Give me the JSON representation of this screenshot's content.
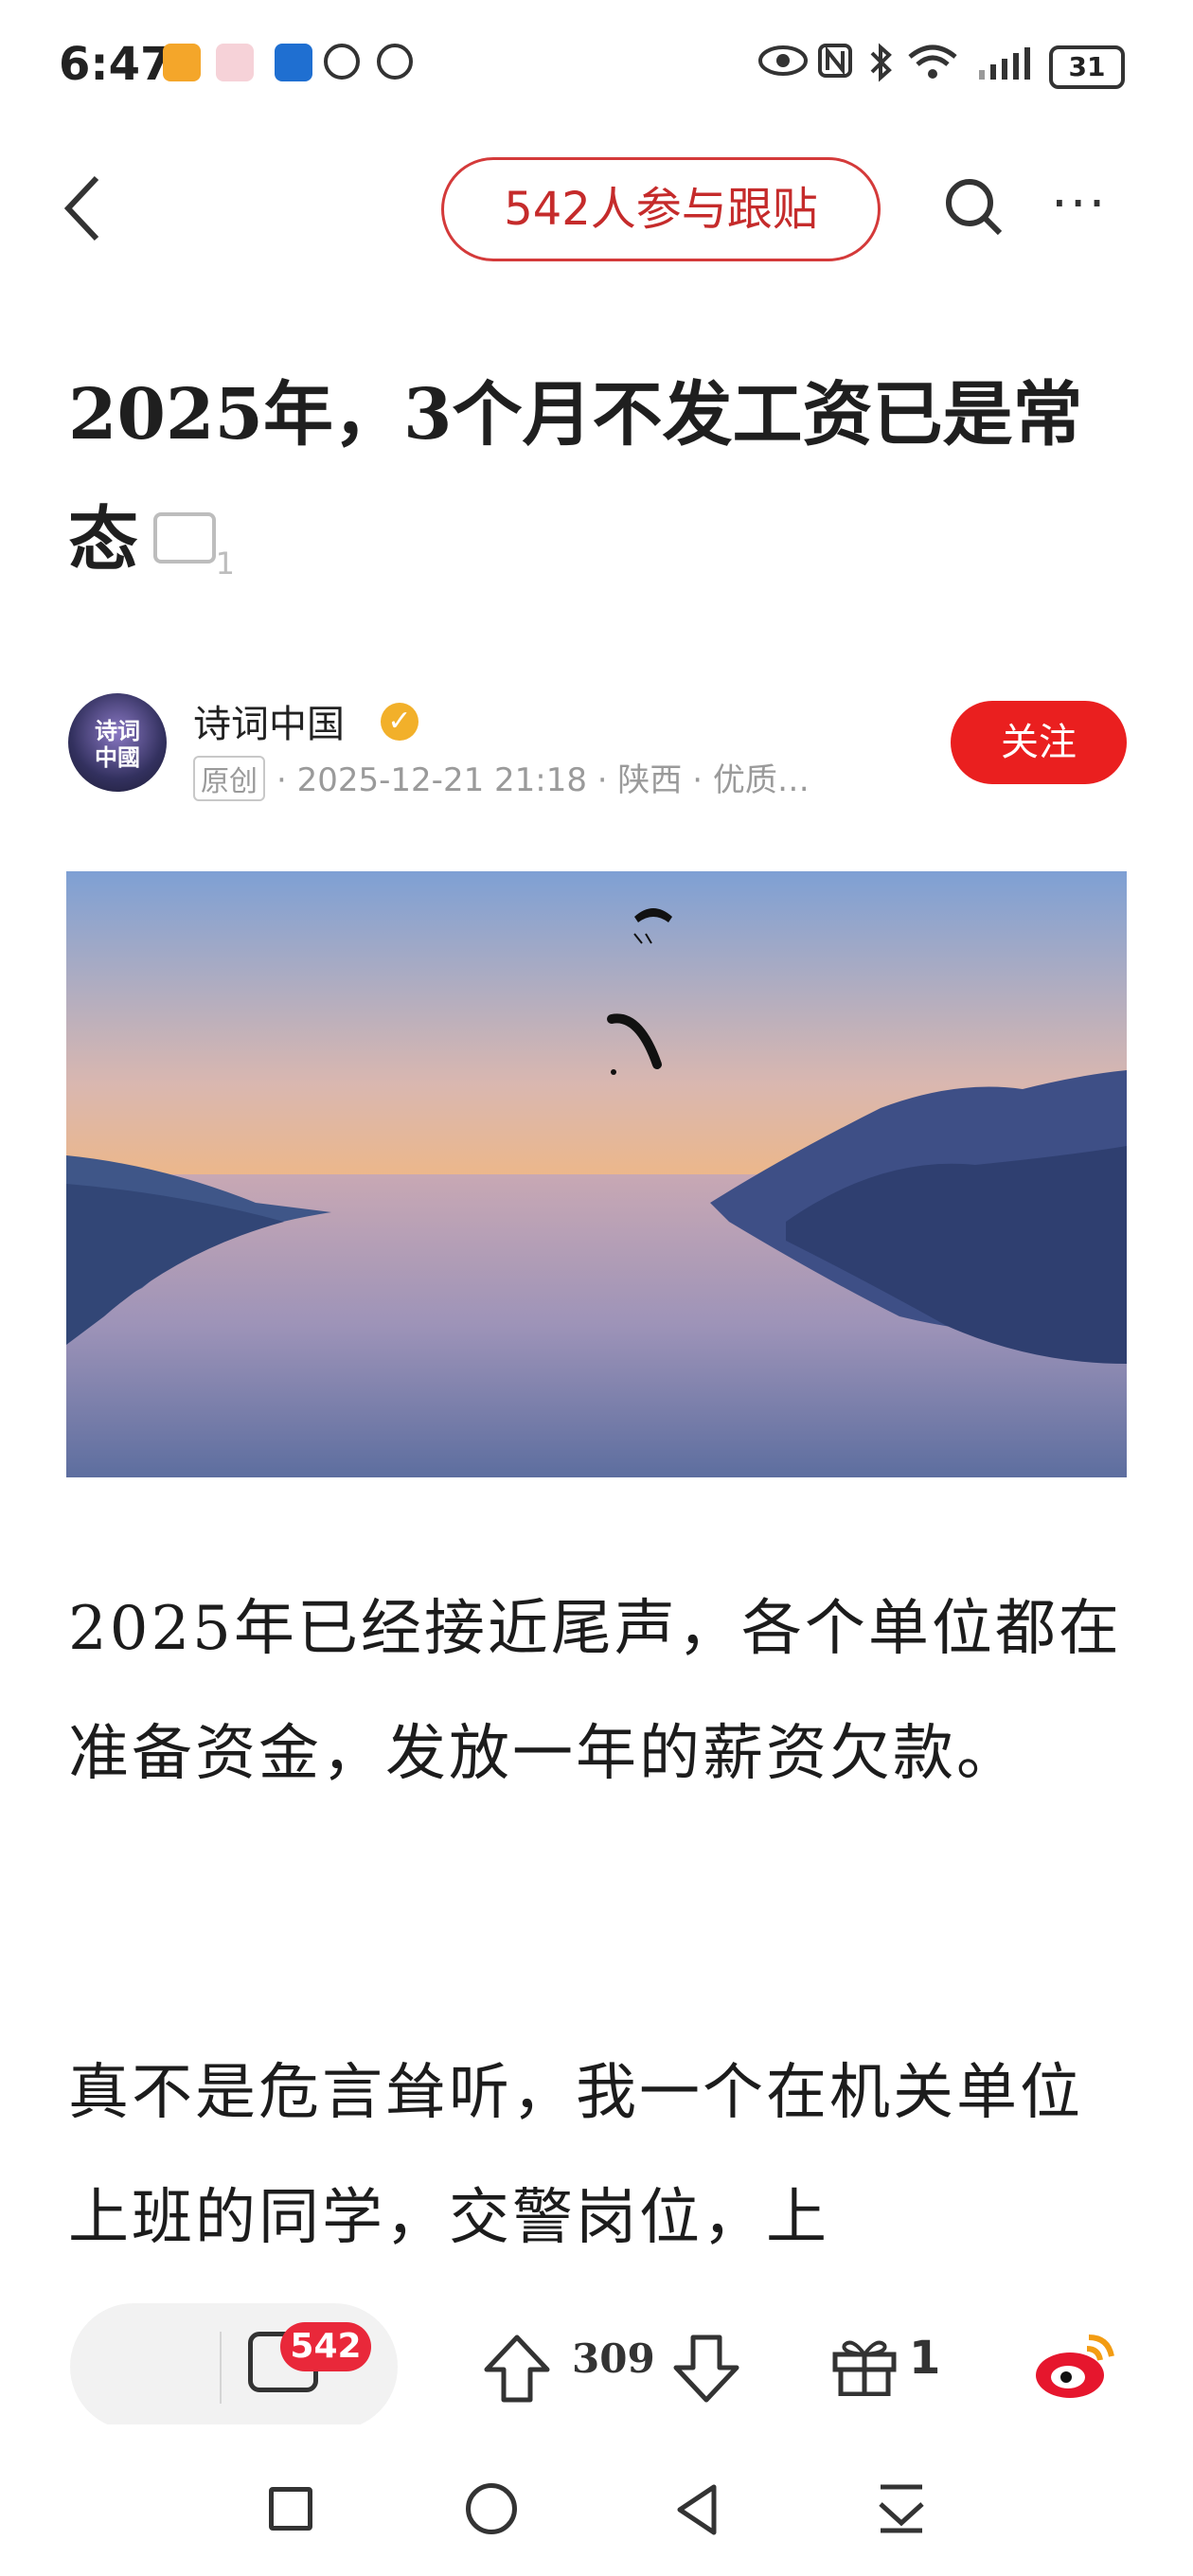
{
  "status_bar": {
    "time": "6:47",
    "battery": "31"
  },
  "nav": {
    "follow_count_label": "542人参与跟贴",
    "more_label": "···"
  },
  "article": {
    "title": "2025年，3个月不发工资已是常态",
    "author": {
      "name": "诗词中国",
      "avatar_text": "诗词\n中國",
      "original_tag": "原创",
      "meta": "· 2025-12-21 21:18 · 陕西 · 优质…",
      "follow_label": "关注"
    },
    "paragraphs": [
      "2025年已经接近尾声，各个单位都在准备资金，发放一年的薪资欠款。",
      "真不是危言耸听，我一个在机关单位上班的同学，交警岗位，上"
    ]
  },
  "action_bar": {
    "comment_count": "542",
    "votes": "309",
    "gift_count": "1"
  },
  "icons": {
    "back": "back-arrow-icon",
    "search": "search-icon",
    "more": "more-icon",
    "comment": "comment-icon",
    "upvote": "upvote-icon",
    "downvote": "downvote-icon",
    "gift": "gift-icon",
    "share": "weibo-icon"
  },
  "colors": {
    "accent_red": "#ea1f1f",
    "pill_border": "#d43a3a",
    "verified": "#f2b02a"
  }
}
